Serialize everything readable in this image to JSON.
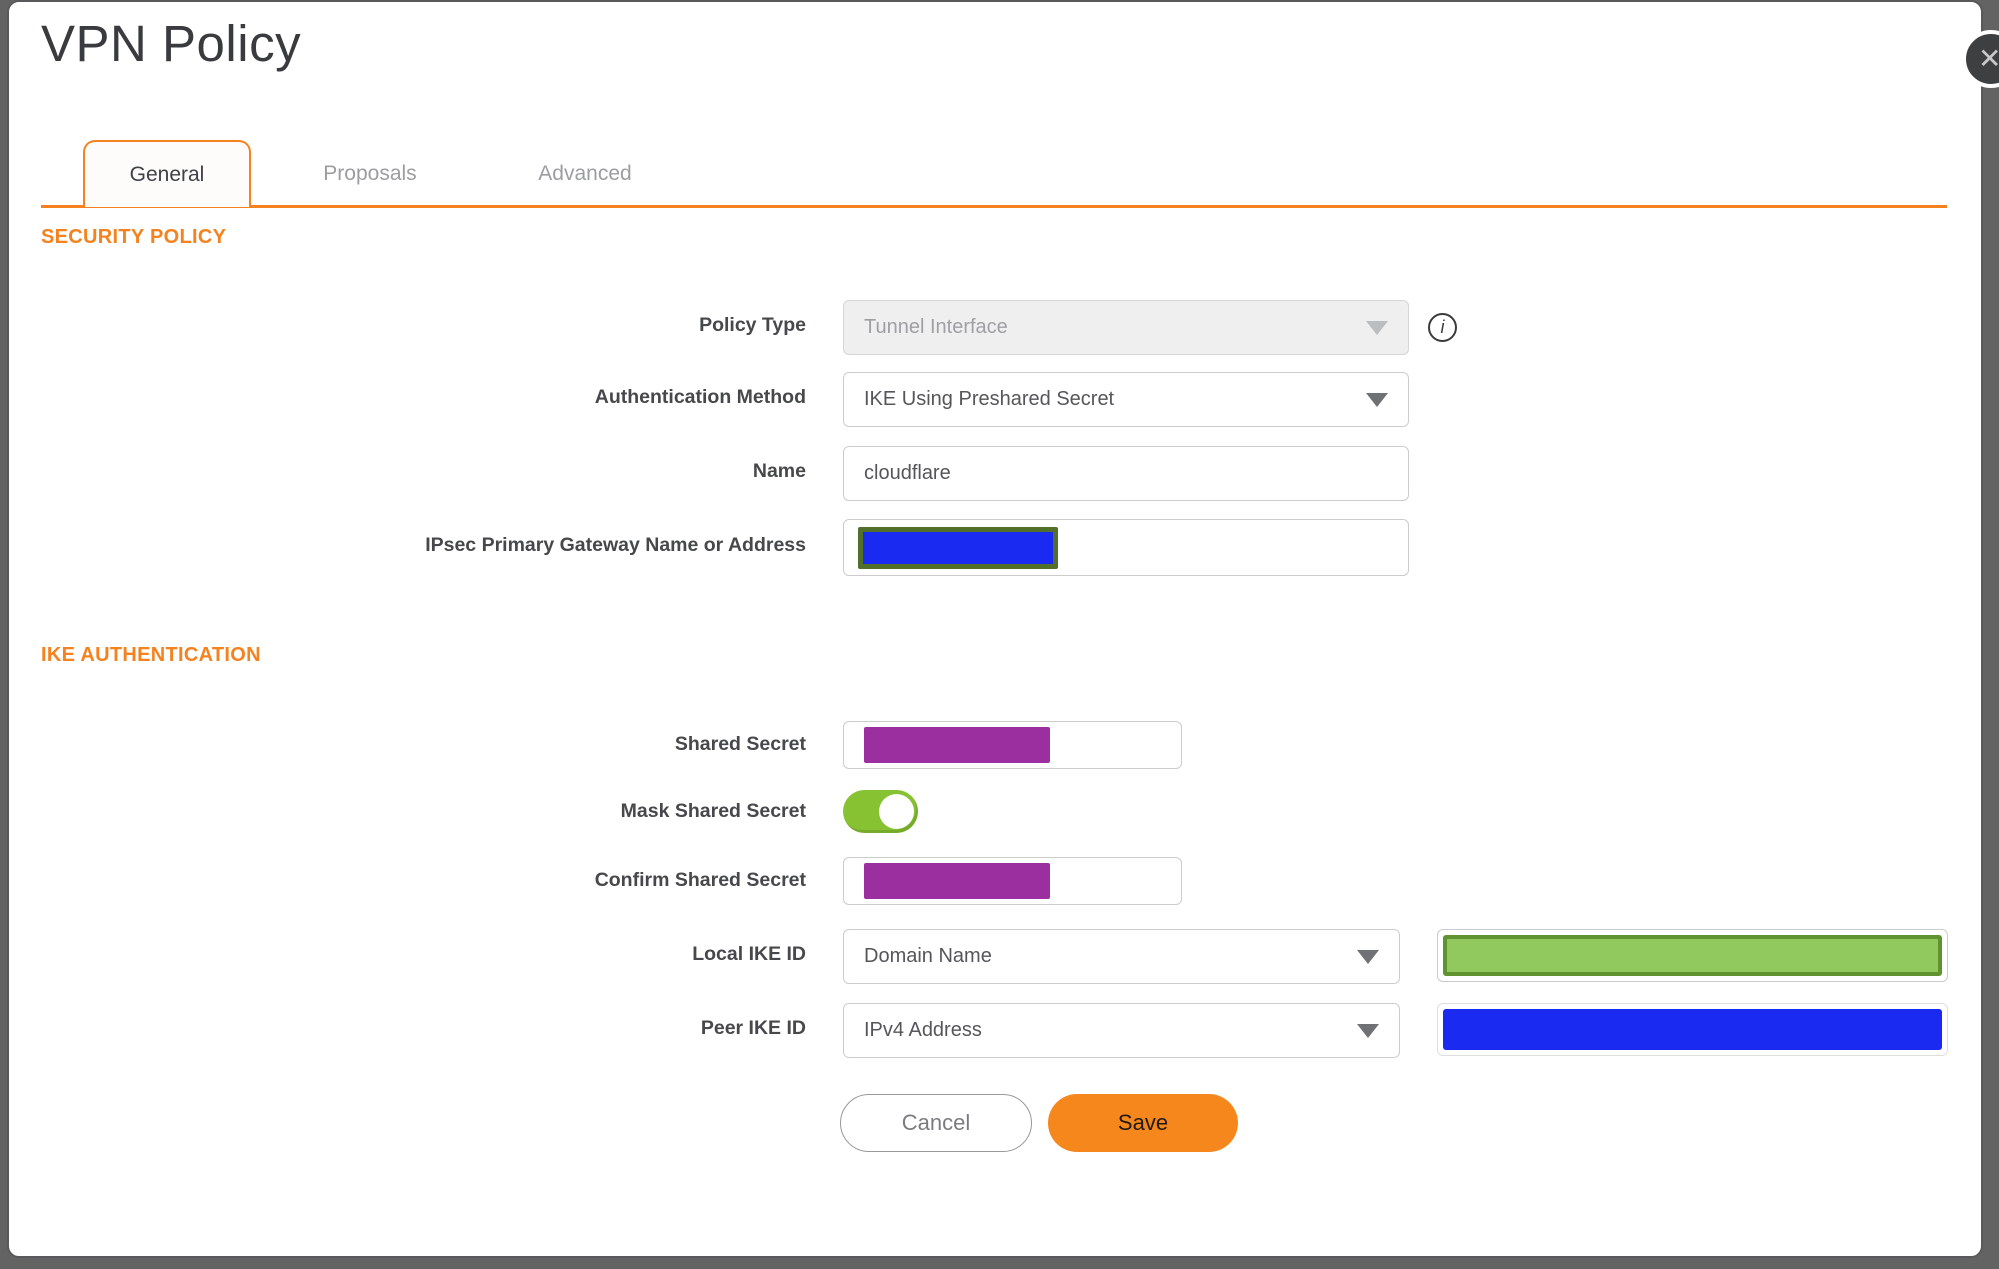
{
  "dialog": {
    "title": "VPN Policy"
  },
  "icons": {
    "close_glyph": "✕",
    "info_glyph": "i"
  },
  "tabs": [
    {
      "label": "General",
      "active": true
    },
    {
      "label": "Proposals",
      "active": false
    },
    {
      "label": "Advanced",
      "active": false
    }
  ],
  "sections": {
    "security_policy": "SECURITY POLICY",
    "ike_authentication": "IKE AUTHENTICATION"
  },
  "form": {
    "policy_type": {
      "label": "Policy Type",
      "value": "Tunnel Interface",
      "disabled": true
    },
    "authentication_method": {
      "label": "Authentication Method",
      "value": "IKE Using Preshared Secret"
    },
    "name": {
      "label": "Name",
      "value": "cloudflare"
    },
    "gateway": {
      "label": "IPsec Primary Gateway Name or Address",
      "value_redacted": true
    },
    "shared_secret": {
      "label": "Shared Secret",
      "value_redacted": true
    },
    "mask_shared_secret": {
      "label": "Mask Shared Secret",
      "state": "on"
    },
    "confirm_shared_secret": {
      "label": "Confirm Shared Secret",
      "value_redacted": true
    },
    "local_ike_id": {
      "label": "Local IKE ID",
      "type_value": "Domain Name",
      "value_redacted": true
    },
    "peer_ike_id": {
      "label": "Peer IKE ID",
      "type_value": "IPv4 Address",
      "value_redacted": true
    }
  },
  "buttons": {
    "cancel": "Cancel",
    "save": "Save"
  },
  "colors": {
    "accent": "#F5821F",
    "save-orange": "#F6871D",
    "toggle-green": "#87C232",
    "redact-purple": "#9B2F9F",
    "redact-blue": "#1B2AF0",
    "redact-green": "#92C95E",
    "redact-green-border": "#5F9330",
    "redact-olive-border": "#526F2A",
    "backdrop": "#636363",
    "disabled-bg": "#EFEFEF",
    "border": "#CCCCCC",
    "label": "#47484C",
    "text": "#55565A",
    "muted": "#9FA0A3",
    "title": "#3A3B3F",
    "tab-inactive": "#9B9DA0"
  }
}
